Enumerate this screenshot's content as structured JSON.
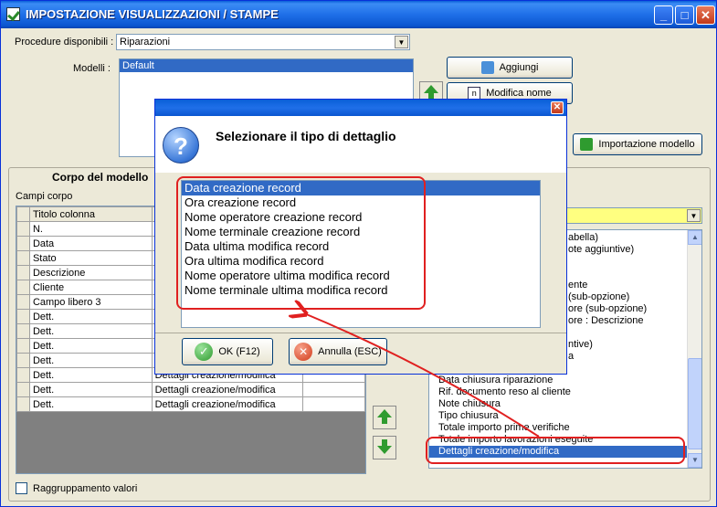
{
  "window": {
    "title": "IMPOSTAZIONE VISUALIZZAZIONI / STAMPE",
    "min_glyph": "_",
    "max_glyph": "□",
    "close_glyph": "✕"
  },
  "top": {
    "procedure_label": "Procedure disponibili :",
    "procedure_value": "Riparazioni",
    "modelli_label": "Modelli :",
    "modelli": [
      "Default"
    ],
    "btn_aggiungi": "Aggiungi",
    "btn_modifica_nome": "Modifica nome",
    "btn_importazione": "Importazione modello"
  },
  "corpo": {
    "group_title": "Corpo del modello",
    "campi_label": "Campi corpo",
    "col_titolo": "Titolo colonna",
    "rows": [
      {
        "titolo": "N.",
        "dettaglio": ""
      },
      {
        "titolo": "Data",
        "dettaglio": ""
      },
      {
        "titolo": "Stato",
        "dettaglio": ""
      },
      {
        "titolo": "Descrizione",
        "dettaglio": ""
      },
      {
        "titolo": "Cliente",
        "dettaglio": ""
      },
      {
        "titolo": "Campo libero 3",
        "dettaglio": ""
      },
      {
        "titolo": "Dett.",
        "dettaglio": ""
      },
      {
        "titolo": "Dett.",
        "dettaglio": ""
      },
      {
        "titolo": "Dett.",
        "dettaglio": ""
      },
      {
        "titolo": "Dett.",
        "dettaglio": ""
      },
      {
        "titolo": "Dett.",
        "dettaglio": "Dettagli creazione/modifica"
      },
      {
        "titolo": "Dett.",
        "dettaglio": "Dettagli creazione/modifica"
      },
      {
        "titolo": "Dett.",
        "dettaglio": "Dettagli creazione/modifica"
      }
    ],
    "raggruppamento_label": "Raggruppamento valori"
  },
  "right_list": {
    "items": [
      "abella)",
      "ote aggiuntive)",
      "",
      "",
      "ente",
      "(sub-opzione)",
      "ore (sub-opzione)",
      "ore : Descrizione",
      "",
      "ntive)",
      "a",
      "",
      "Data chiusura riparazione",
      "Rif. documento reso al cliente",
      "Note chiusura",
      "Tipo chiusura",
      "Totale importo prime verifiche",
      "Totale importo lavorazioni eseguite",
      "Dettagli creazione/modifica"
    ],
    "selected_index": 18
  },
  "dialog": {
    "close_glyph": "✕",
    "icon_glyph": "?",
    "heading": "Selezionare il tipo di dettaglio",
    "items": [
      "Data creazione record",
      "Ora creazione record",
      "Nome operatore creazione record",
      "Nome terminale creazione record",
      "Data ultima modifica record",
      "Ora ultima modifica record",
      "Nome operatore ultima modifica record",
      "Nome terminale ultima modifica record"
    ],
    "selected_index": 0,
    "ok_label": "OK (F12)",
    "cancel_label": "Annulla (ESC)"
  },
  "colors": {
    "selection": "#316ac5",
    "annotation": "#e02020",
    "yellow_combo": "#ffff80"
  }
}
